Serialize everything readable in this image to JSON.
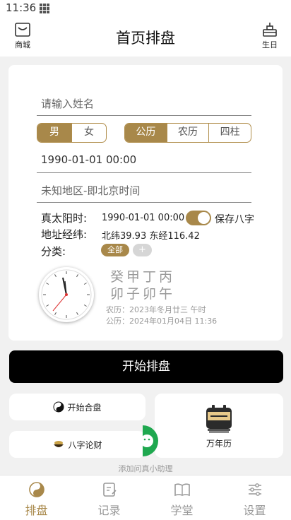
{
  "status": {
    "time": "11:36"
  },
  "header": {
    "title": "首页排盘",
    "left_label": "商城",
    "right_label": "生日"
  },
  "form": {
    "name_placeholder": "请输入姓名",
    "gender": [
      "男",
      "女"
    ],
    "calendar": [
      "公历",
      "农历",
      "四柱"
    ],
    "datetime": "1990-01-01 00:00",
    "location_placeholder": "未知地区-即北京时间"
  },
  "info": {
    "solar_label": "真太阳时:",
    "solar_value": "1990-01-01 00:00",
    "save_label": "保存八字",
    "coord_label": "地址经纬:",
    "coord_value": "北纬39.93 东经116.42",
    "category_label": "分类:",
    "category_all": "全部",
    "category_add": "+"
  },
  "bazi": {
    "stems": "癸甲丁丙",
    "branches": "卯子卯午",
    "lunar": "农历：2023年冬月廿三 午时",
    "solar": "公历：2024年01月04日 11:36"
  },
  "actions": {
    "start": "开始排盘",
    "hepan": "开始合盘",
    "lucai": "八字论财",
    "calendar": "万年历",
    "helper": "添加问真小助理"
  },
  "tabs": [
    "排盘",
    "记录",
    "学堂",
    "设置"
  ],
  "colors": {
    "accent": "#a8884a",
    "primary_button": "#000000"
  }
}
